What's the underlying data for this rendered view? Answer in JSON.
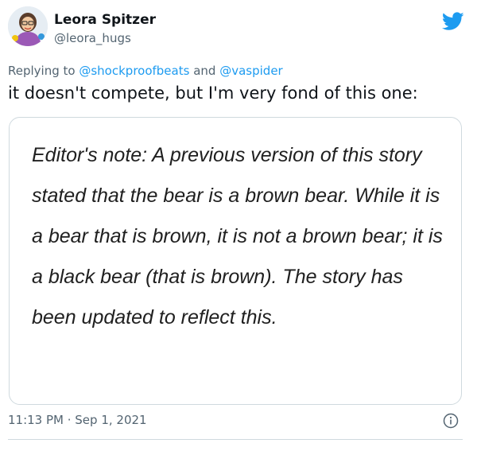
{
  "author": {
    "display_name": "Leora Spitzer",
    "handle": "@leora_hugs",
    "avatar_icon": "bitmoji-avatar"
  },
  "platform_icon": "twitter-bird-icon",
  "colors": {
    "accent": "#1d9bf0",
    "secondary_text": "#536471",
    "border": "#cfd9de"
  },
  "reply": {
    "prefix": "Replying to",
    "user1": "@shockproofbeats",
    "conjunction": "and",
    "user2": "@vaspider"
  },
  "tweet_text": "it doesn't compete, but I'm very fond of this one:",
  "card": {
    "text": "Editor's note: A previous version of this story stated that the bear is a brown bear. While it is a bear that is brown, it is not a brown bear; it is a black bear (that is brown). The story has been updated to reflect this."
  },
  "timestamp": "11:13 PM · Sep 1, 2021",
  "info_icon": "info-icon"
}
